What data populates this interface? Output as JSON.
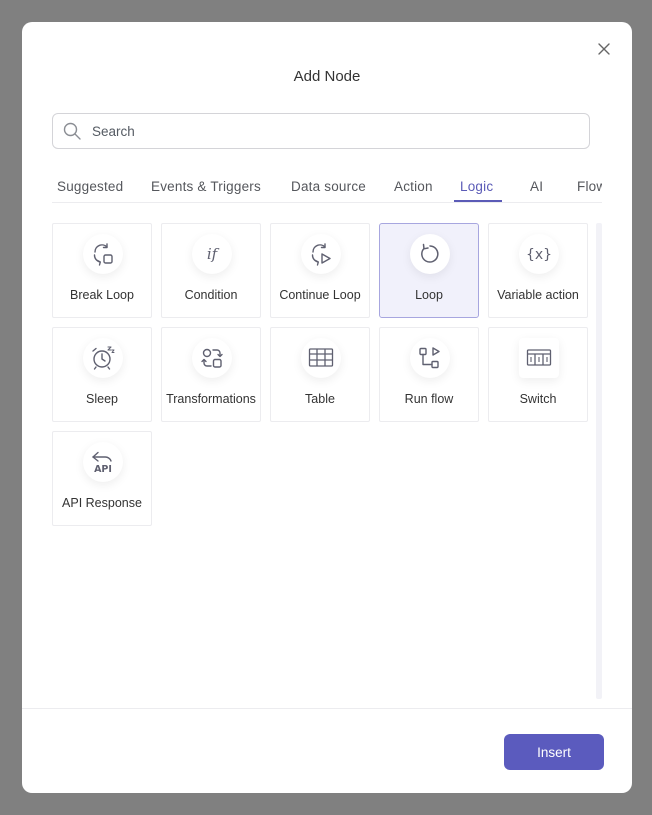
{
  "dialog": {
    "title": "Add Node",
    "close_icon": "close-icon"
  },
  "search": {
    "placeholder": "Search",
    "value": "",
    "icon": "search-icon"
  },
  "tabs": [
    {
      "label": "Suggested",
      "active": false
    },
    {
      "label": "Events & Triggers",
      "active": false
    },
    {
      "label": "Data source",
      "active": false
    },
    {
      "label": "Action",
      "active": false
    },
    {
      "label": "Logic",
      "active": true
    },
    {
      "label": "AI",
      "active": false
    },
    {
      "label": "Flow",
      "active": false
    }
  ],
  "nodes": [
    {
      "label": "Break Loop",
      "icon": "break-loop-icon",
      "selected": false
    },
    {
      "label": "Condition",
      "icon": "if-condition-icon",
      "selected": false
    },
    {
      "label": "Continue Loop",
      "icon": "continue-loop-icon",
      "selected": false
    },
    {
      "label": "Loop",
      "icon": "loop-icon",
      "selected": true
    },
    {
      "label": "Variable action",
      "icon": "variable-icon",
      "selected": false
    },
    {
      "label": "Sleep",
      "icon": "alarm-clock-icon",
      "selected": false
    },
    {
      "label": "Transformations",
      "icon": "transform-icon",
      "selected": false
    },
    {
      "label": "Table",
      "icon": "table-icon",
      "selected": false
    },
    {
      "label": "Run flow",
      "icon": "run-flow-icon",
      "selected": false
    },
    {
      "label": "Switch",
      "icon": "switch-icon",
      "selected": false
    },
    {
      "label": "API Response",
      "icon": "api-response-icon",
      "selected": false
    }
  ],
  "footer": {
    "insert_label": "Insert"
  },
  "colors": {
    "accent": "#5b5bbe",
    "icon": "#5f6070",
    "overlay": "#808080",
    "selected_bg": "#f1f1fb",
    "selected_border": "#a7a6df"
  }
}
